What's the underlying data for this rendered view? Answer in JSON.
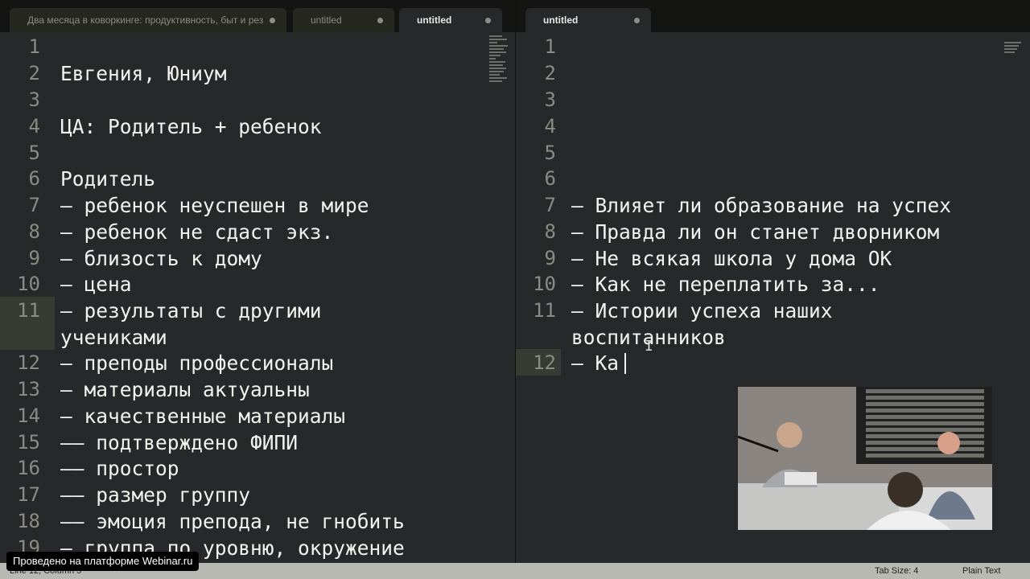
{
  "tabs_left": [
    {
      "label": "Два месяца в коворкинге: продуктивность, быт и рез",
      "active": false
    },
    {
      "label": "untitled",
      "active": false
    },
    {
      "label": "untitled",
      "active": true
    }
  ],
  "tabs_right": [
    {
      "label": "untitled",
      "active": true
    }
  ],
  "left_lines": [
    {
      "n": "1",
      "text": ""
    },
    {
      "n": "2",
      "text": "Евгения, Юниум"
    },
    {
      "n": "3",
      "text": ""
    },
    {
      "n": "4",
      "text": "ЦА: Родитель + ребенок"
    },
    {
      "n": "5",
      "text": ""
    },
    {
      "n": "6",
      "text": "Родитель"
    },
    {
      "n": "7",
      "text": "— ребенок неуспешен в мире"
    },
    {
      "n": "8",
      "text": "— ребенок не сдаст экз."
    },
    {
      "n": "9",
      "text": "— близость к дому"
    },
    {
      "n": "10",
      "text": "— цена"
    },
    {
      "n": "11",
      "text": "— результаты с другими\nучениками"
    },
    {
      "n": "12",
      "text": "— преподы профессионалы"
    },
    {
      "n": "13",
      "text": "— материалы актуальны"
    },
    {
      "n": "14",
      "text": "— качественные материалы"
    },
    {
      "n": "15",
      "text": "—— подтверждено ФИПИ"
    },
    {
      "n": "16",
      "text": "—— простор"
    },
    {
      "n": "17",
      "text": "—— размер группу"
    },
    {
      "n": "18",
      "text": "—— эмоция препода, не гнобить"
    },
    {
      "n": "19",
      "text": "— группа по уровню, окружение"
    }
  ],
  "right_lines": [
    {
      "n": "1",
      "text": ""
    },
    {
      "n": "2",
      "text": ""
    },
    {
      "n": "3",
      "text": ""
    },
    {
      "n": "4",
      "text": ""
    },
    {
      "n": "5",
      "text": ""
    },
    {
      "n": "6",
      "text": ""
    },
    {
      "n": "7",
      "text": "— Влияет ли образование на успех"
    },
    {
      "n": "8",
      "text": "— Правда ли он станет дворником"
    },
    {
      "n": "9",
      "text": "— Не всякая школа у дома ОК"
    },
    {
      "n": "10",
      "text": "— Как не переплатить за..."
    },
    {
      "n": "11",
      "text": "— Истории успеха наших\nвоспитанников"
    },
    {
      "n": "12",
      "text": "— Ка"
    }
  ],
  "status": {
    "position": "Line 12, Column 5",
    "tab_size": "Tab Size: 4",
    "syntax": "Plain Text"
  },
  "watermark": "Проведено на платформе Webinar.ru"
}
